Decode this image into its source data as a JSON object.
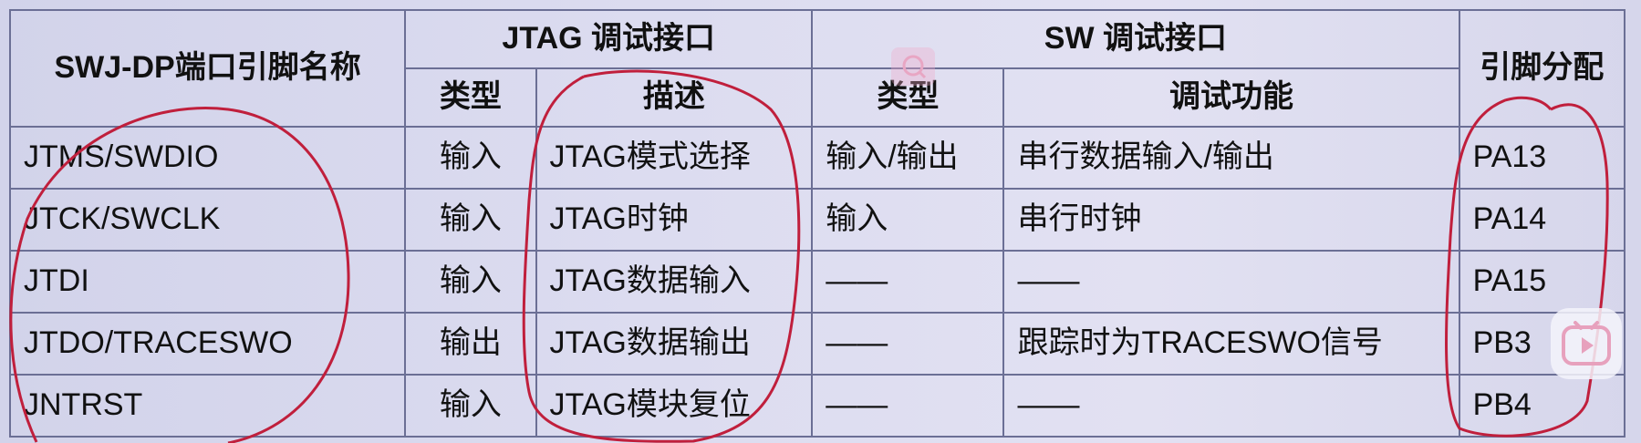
{
  "header": {
    "pin_name": "SWJ-DP端口引脚名称",
    "jtag_group": "JTAG 调试接口",
    "sw_group": "SW 调试接口",
    "pin_assign": "引脚分配",
    "jtag_type": "类型",
    "jtag_desc": "描述",
    "sw_type": "类型",
    "sw_func": "调试功能"
  },
  "rows": [
    {
      "pin": "JTMS/SWDIO",
      "jtag_type": "输入",
      "jtag_desc": "JTAG模式选择",
      "sw_type": "输入/输出",
      "sw_func": "串行数据输入/输出",
      "assign": "PA13"
    },
    {
      "pin": "JTCK/SWCLK",
      "jtag_type": "输入",
      "jtag_desc": "JTAG时钟",
      "sw_type": "输入",
      "sw_func": "串行时钟",
      "assign": "PA14"
    },
    {
      "pin": "JTDI",
      "jtag_type": "输入",
      "jtag_desc": "JTAG数据输入",
      "sw_type": "——",
      "sw_func": "——",
      "assign": "PA15"
    },
    {
      "pin": "JTDO/TRACESWO",
      "jtag_type": "输出",
      "jtag_desc": "JTAG数据输出",
      "sw_type": "——",
      "sw_func": "跟踪时为TRACESWO信号",
      "assign": "PB3"
    },
    {
      "pin": "JNTRST",
      "jtag_type": "输入",
      "jtag_desc": "JTAG模块复位",
      "sw_type": "——",
      "sw_func": "——",
      "assign": "PB4"
    }
  ],
  "colors": {
    "annotation": "#c01f3c",
    "border": "#6b6f95"
  },
  "icons": {
    "watermark": "watermark-icon",
    "play": "play-icon"
  }
}
